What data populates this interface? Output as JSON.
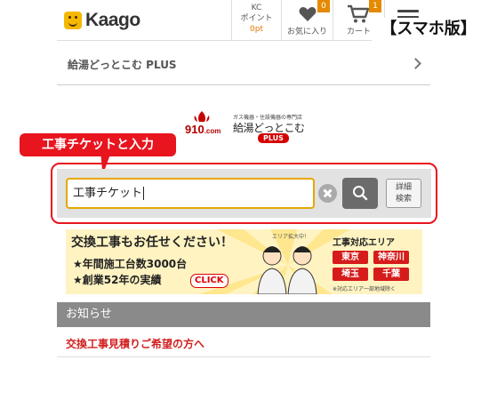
{
  "header": {
    "logo_text": "Kaago",
    "kc_line1": "KC",
    "kc_line2": "ポイント",
    "kc_points": "0pt",
    "favorites_label": "お気に入り",
    "favorites_count": "0",
    "cart_label": "カート",
    "cart_count": "1",
    "edition_label": "【スマホ版】"
  },
  "breadcrumb": {
    "label": "給湯どっとこむ PLUS"
  },
  "site_logo": {
    "prefix": "910",
    "suffix": ".com",
    "subtitle": "ガス機器・住設機器の専門店",
    "name": "給湯どっとこむ",
    "badge": "PLUS"
  },
  "callout": {
    "text": "工事チケットと入力"
  },
  "search": {
    "value": "工事チケット",
    "detail_line1": "詳細",
    "detail_line2": "検索"
  },
  "banner": {
    "title": "交換工事もお任せください！",
    "line1": "★年間施工台数3000台",
    "line2": "★創業52年の実績",
    "click_label": "CLICK",
    "expand_label": "エリア拡大中！",
    "area_title": "工事対応エリア",
    "areas": [
      "東京",
      "神奈川",
      "埼玉",
      "千葉"
    ],
    "area_note": "※対応エリア一部地域除く"
  },
  "news": {
    "heading": "お知らせ",
    "items": [
      {
        "text": "交換工事見積りご希望の方へ"
      }
    ]
  },
  "colors": {
    "accent_red": "#e8141e",
    "input_border": "#e6a800",
    "badge_orange": "#e58a00"
  }
}
